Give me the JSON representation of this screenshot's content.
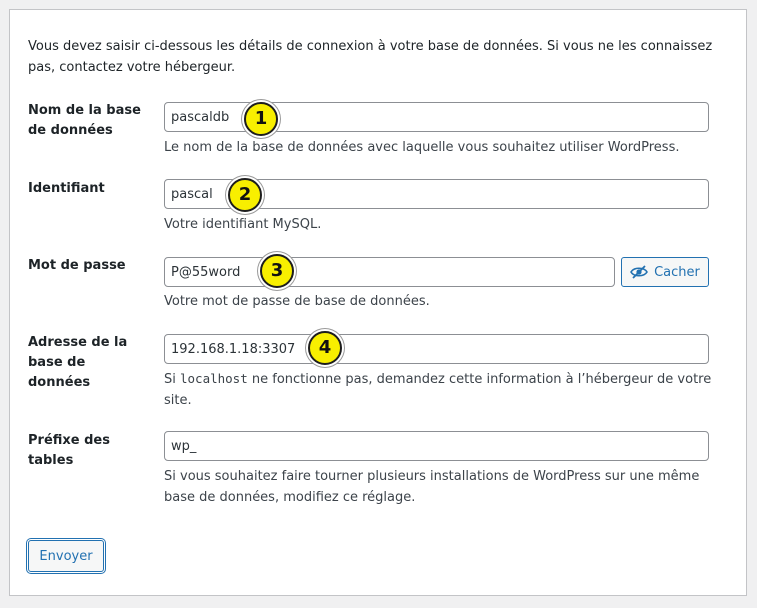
{
  "intro": "Vous devez saisir ci-dessous les détails de connexion à votre base de données. Si vous ne les connaissez pas, contactez votre hébergeur.",
  "fields": {
    "dbname": {
      "label": "Nom de la base de données",
      "value": "pascaldb",
      "description": "Le nom de la base de données avec laquelle vous souhaitez utiliser WordPress.",
      "badge": "1"
    },
    "username": {
      "label": "Identifiant",
      "value": "pascal",
      "description": "Votre identifiant MySQL.",
      "badge": "2"
    },
    "password": {
      "label": "Mot de passe",
      "value": "P@55word",
      "description": "Votre mot de passe de base de données.",
      "badge": "3",
      "toggle_label": "Cacher",
      "toggle_icon": "eye-slash-icon"
    },
    "dbhost": {
      "label": "Adresse de la base de données",
      "value": "192.168.1.18:3307",
      "description_before": "Si ",
      "description_code": "localhost",
      "description_after": " ne fonctionne pas, demandez cette information à l’hébergeur de votre site.",
      "badge": "4"
    },
    "prefix": {
      "label": "Préfixe des tables",
      "value": "wp_",
      "description": "Si vous souhaitez faire tourner plusieurs installations de WordPress sur une même base de données, modifiez ce réglage."
    }
  },
  "submit_label": "Envoyer",
  "colors": {
    "accent": "#2271b1",
    "badge": "#f8ef00",
    "background": "#f0f0f1"
  }
}
